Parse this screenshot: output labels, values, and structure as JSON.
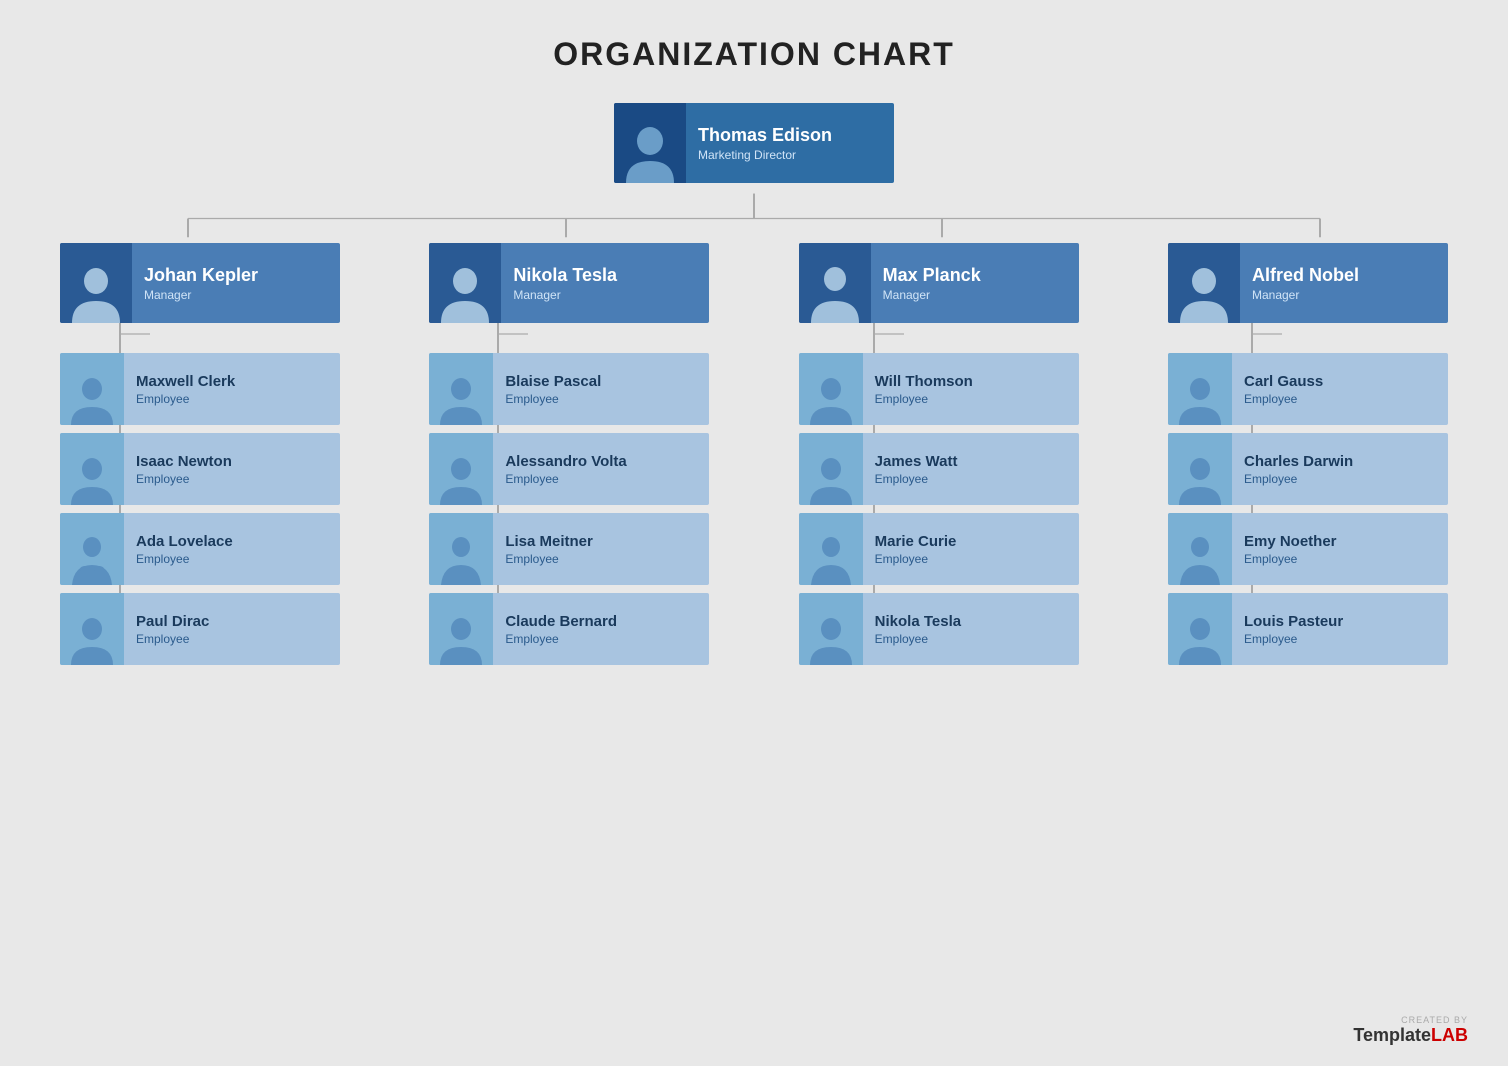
{
  "title": "ORGANIZATION CHART",
  "colors": {
    "manager_bg": "#4a7db5",
    "top_bg": "#2e6da4",
    "employee_bg": "#a8c4e0",
    "connector": "#999",
    "manager_avatar": "#2a5a94",
    "employee_avatar": "#7ab0d4"
  },
  "top": {
    "name": "Thomas Edison",
    "role": "Marketing Director"
  },
  "branches": [
    {
      "manager": {
        "name": "Johan Kepler",
        "role": "Manager"
      },
      "employees": [
        {
          "name": "Maxwell Clerk",
          "role": "Employee"
        },
        {
          "name": "Isaac Newton",
          "role": "Employee"
        },
        {
          "name": "Ada Lovelace",
          "role": "Employee"
        },
        {
          "name": "Paul Dirac",
          "role": "Employee"
        }
      ]
    },
    {
      "manager": {
        "name": "Nikola Tesla",
        "role": "Manager"
      },
      "employees": [
        {
          "name": "Blaise Pascal",
          "role": "Employee"
        },
        {
          "name": "Alessandro Volta",
          "role": "Employee"
        },
        {
          "name": "Lisa Meitner",
          "role": "Employee"
        },
        {
          "name": "Claude Bernard",
          "role": "Employee"
        }
      ]
    },
    {
      "manager": {
        "name": "Max Planck",
        "role": "Manager"
      },
      "employees": [
        {
          "name": "Will Thomson",
          "role": "Employee"
        },
        {
          "name": "James Watt",
          "role": "Employee"
        },
        {
          "name": "Marie Curie",
          "role": "Employee"
        },
        {
          "name": "Nikola Tesla",
          "role": "Employee"
        }
      ]
    },
    {
      "manager": {
        "name": "Alfred Nobel",
        "role": "Manager"
      },
      "employees": [
        {
          "name": "Carl Gauss",
          "role": "Employee"
        },
        {
          "name": "Charles Darwin",
          "role": "Employee"
        },
        {
          "name": "Emy Noether",
          "role": "Employee"
        },
        {
          "name": "Louis Pasteur",
          "role": "Employee"
        }
      ]
    }
  ],
  "watermark": {
    "created_by": "CREATED BY",
    "brand": "Template",
    "brand_highlight": "LAB"
  }
}
